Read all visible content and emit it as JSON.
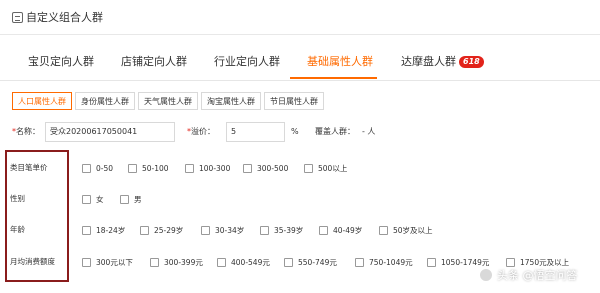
{
  "header": {
    "title": "自定义组合人群"
  },
  "tabs": [
    {
      "label": "宝贝定向人群"
    },
    {
      "label": "店铺定向人群"
    },
    {
      "label": "行业定向人群"
    },
    {
      "label": "基础属性人群"
    },
    {
      "label": "达摩盘人群",
      "badge": "618"
    }
  ],
  "subtabs": [
    {
      "label": "人口属性人群"
    },
    {
      "label": "身份属性人群"
    },
    {
      "label": "天气属性人群"
    },
    {
      "label": "淘宝属性人群"
    },
    {
      "label": "节日属性人群"
    }
  ],
  "form": {
    "name_required": "*",
    "name_label": "名称：",
    "name_value": "受众20200617050041",
    "bid_required": "*",
    "bid_label": "溢价：",
    "bid_value": "5",
    "bid_unit": "%",
    "coverage_label": "覆盖人群：",
    "coverage_value": "- 人"
  },
  "attributes": [
    {
      "label": "类目笔单价",
      "options": [
        "0-50",
        "50-100",
        "100-300",
        "300-500",
        "500以上"
      ]
    },
    {
      "label": "性别",
      "options": [
        "女",
        "男"
      ]
    },
    {
      "label": "年龄",
      "options": [
        "18-24岁",
        "25-29岁",
        "30-34岁",
        "35-39岁",
        "40-49岁",
        "50岁及以上"
      ]
    },
    {
      "label": "月均消费额度",
      "options": [
        "300元以下",
        "300-399元",
        "400-549元",
        "550-749元",
        "750-1049元",
        "1050-1749元",
        "1750元及以上"
      ]
    }
  ],
  "watermark": {
    "text": "头条 @悟空问答"
  },
  "colors": {
    "accent": "#ff6a00",
    "badge": "#e2231a",
    "highlight_border": "#8a1c1c"
  }
}
